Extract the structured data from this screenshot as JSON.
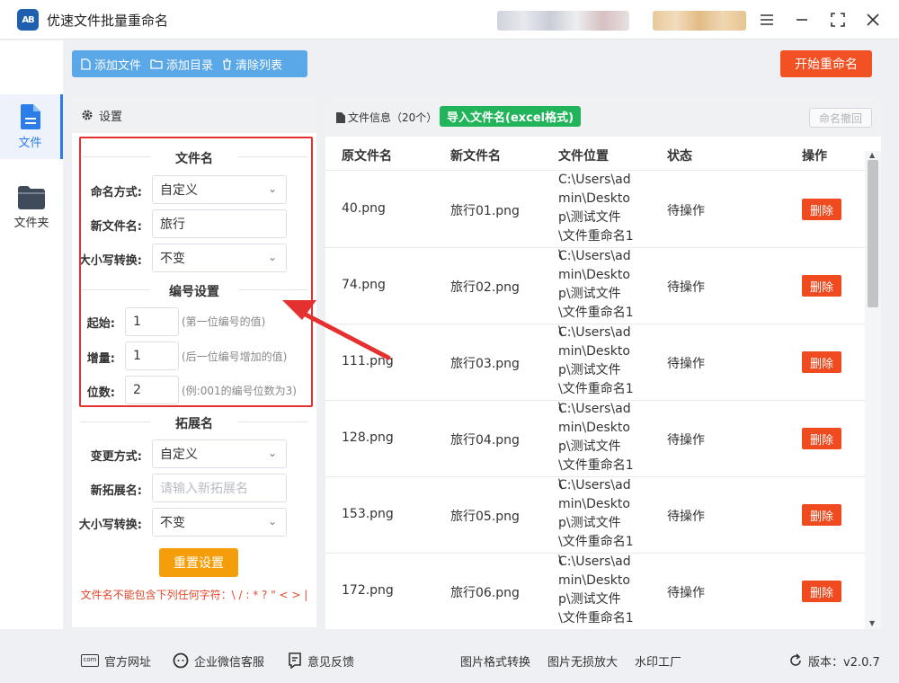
{
  "app": {
    "title": "优速文件批量重命名",
    "logo_text": "AB"
  },
  "sidebar": {
    "items": [
      {
        "label": "文件"
      },
      {
        "label": "文件夹"
      }
    ]
  },
  "toolbar": {
    "add_files": "添加文件",
    "add_dir": "添加目录",
    "clear_list": "清除列表",
    "start": "开始重命名"
  },
  "settings": {
    "header": "设置",
    "filename": {
      "title": "文件名",
      "mode_label": "命名方式:",
      "mode_value": "自定义",
      "newname_label": "新文件名:",
      "newname_value": "旅行",
      "case_label": "大小写转换:",
      "case_value": "不变"
    },
    "numbering": {
      "title": "编号设置",
      "start_label": "起始:",
      "start_value": "1",
      "start_hint": "(第一位编号的值)",
      "step_label": "增量:",
      "step_value": "1",
      "step_hint": "(后一位编号增加的值)",
      "digits_label": "位数:",
      "digits_value": "2",
      "digits_hint": "(例:001的编号位数为3)"
    },
    "extension": {
      "title": "拓展名",
      "mode_label": "变更方式:",
      "mode_value": "自定义",
      "new_label": "新拓展名:",
      "new_placeholder": "请输入新拓展名",
      "case_label": "大小写转换:",
      "case_value": "不变"
    },
    "reset": "重置设置",
    "warning": "文件名不能包含下列任何字符：\\ / : * ? \" < > |"
  },
  "files": {
    "info_label": "文件信息（20个）",
    "import_btn": "导入文件名(excel格式)",
    "undo_btn": "命名撤回",
    "columns": [
      "原文件名",
      "新文件名",
      "文件位置",
      "状态",
      "操作"
    ],
    "rows": [
      {
        "original": "40.png",
        "new": "旅行01.png",
        "location": "C:\\Users\\admin\\Desktop\\测试文件\\文件重命名1\\",
        "status": "待操作",
        "action": "删除"
      },
      {
        "original": "74.png",
        "new": "旅行02.png",
        "location": "C:\\Users\\admin\\Desktop\\测试文件\\文件重命名1\\",
        "status": "待操作",
        "action": "删除"
      },
      {
        "original": "111.png",
        "new": "旅行03.png",
        "location": "C:\\Users\\admin\\Desktop\\测试文件\\文件重命名1\\",
        "status": "待操作",
        "action": "删除"
      },
      {
        "original": "128.png",
        "new": "旅行04.png",
        "location": "C:\\Users\\admin\\Desktop\\测试文件\\文件重命名1\\",
        "status": "待操作",
        "action": "删除"
      },
      {
        "original": "153.png",
        "new": "旅行05.png",
        "location": "C:\\Users\\admin\\Desktop\\测试文件\\文件重命名1\\",
        "status": "待操作",
        "action": "删除"
      },
      {
        "original": "172.png",
        "new": "旅行06.png",
        "location": "C:\\Users\\admin\\Desktop\\测试文件\\文件重命名1\\",
        "status": "待操作",
        "action": "删除"
      }
    ]
  },
  "footer": {
    "website": "官方网址",
    "wechat": "企业微信客服",
    "feedback": "意见反馈",
    "format_convert": "图片格式转换",
    "lossless_zoom": "图片无损放大",
    "watermark": "水印工厂",
    "version": "版本：v2.0.7",
    "website_icon_text": "com"
  },
  "colors": {
    "accent": "#2b7de9",
    "toolbar": "#5ba8e8",
    "start": "#f25123",
    "import": "#22b45a",
    "reset": "#f59e0b",
    "delete": "#f04a20",
    "highlight": "#e53030"
  }
}
